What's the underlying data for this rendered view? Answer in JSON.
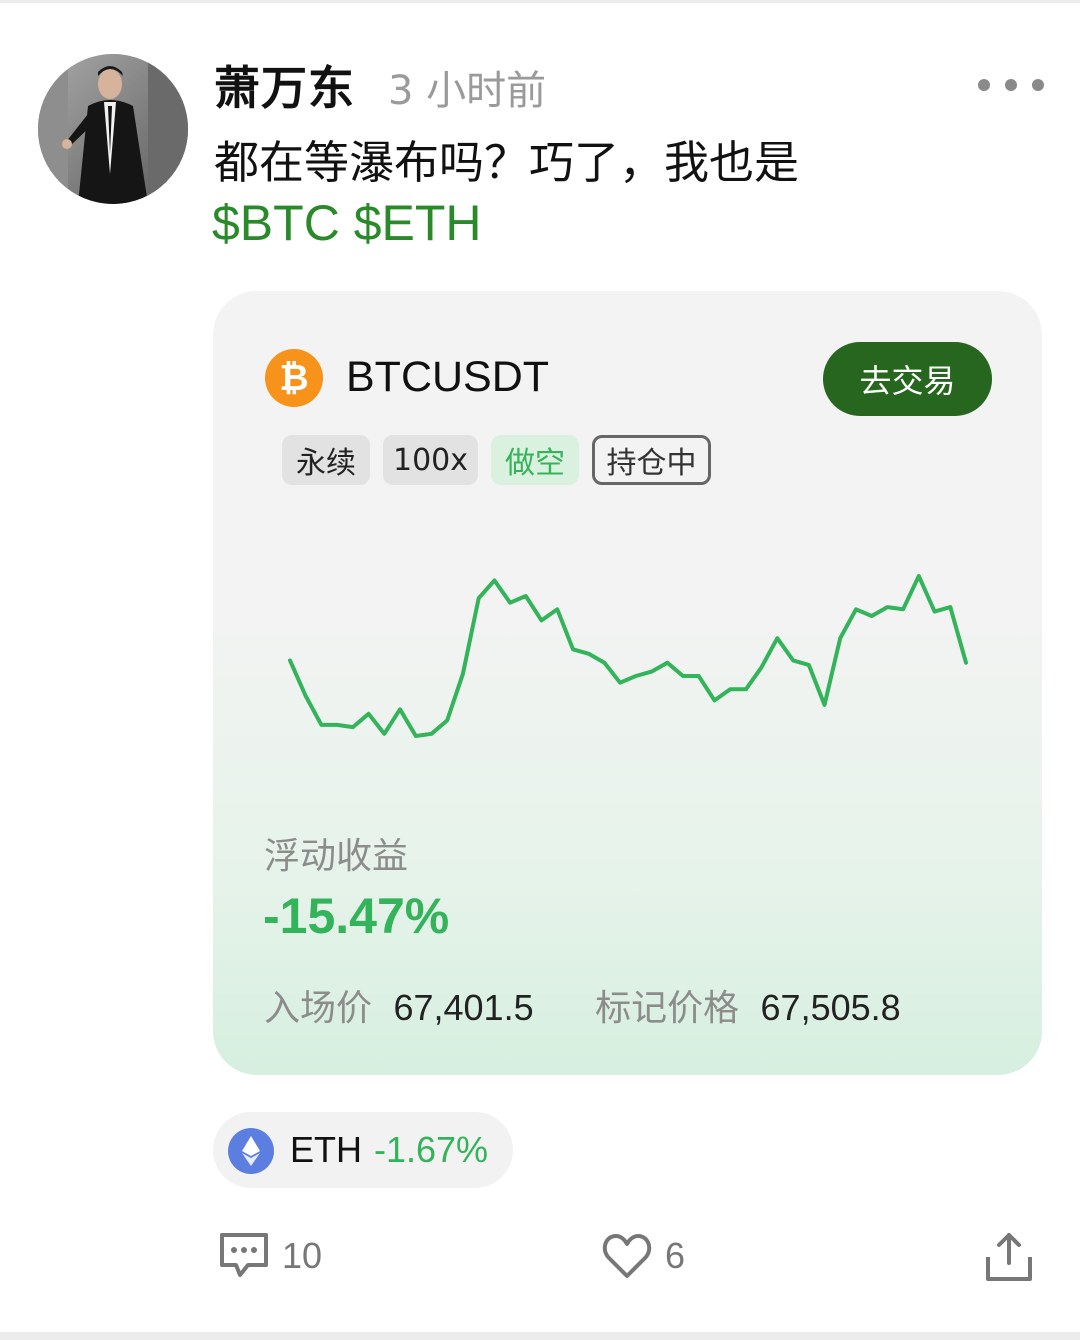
{
  "post": {
    "username": "萧万东",
    "time": "3 小时前",
    "text": "都在等瀑布吗？巧了，我也是",
    "tickers": [
      "$BTC",
      "$ETH"
    ]
  },
  "card": {
    "symbol": "BTCUSDT",
    "trade_button": "去交易",
    "tags": {
      "type": "永续",
      "leverage": "100x",
      "side": "做空",
      "status": "持仓中"
    },
    "pnl_label": "浮动收益",
    "pnl_value": "-15.47%",
    "entry_label": "入场价",
    "entry_value": "67,401.5",
    "mark_label": "标记价格",
    "mark_value": "67,505.8"
  },
  "chart_data": {
    "type": "line",
    "title": "",
    "xlabel": "",
    "ylabel": "",
    "color": "#33b35a",
    "y": [
      62,
      46,
      33,
      33,
      32,
      38,
      29,
      40,
      28,
      29,
      35,
      56,
      90,
      98,
      88,
      91,
      80,
      85,
      67,
      65,
      61,
      52,
      55,
      57,
      61,
      55,
      55,
      44,
      49,
      49,
      59,
      72,
      62,
      60,
      42,
      72,
      85,
      82,
      86,
      85,
      100,
      84,
      86,
      61
    ]
  },
  "eth": {
    "symbol": "ETH",
    "change": "-1.67%"
  },
  "actions": {
    "comments": "10",
    "likes": "6"
  },
  "colors": {
    "accent_green": "#33b35a",
    "button_green": "#26661f",
    "ticker_green": "#2a8a2a",
    "btc_orange": "#f7931a",
    "eth_blue": "#5b7ee0"
  }
}
